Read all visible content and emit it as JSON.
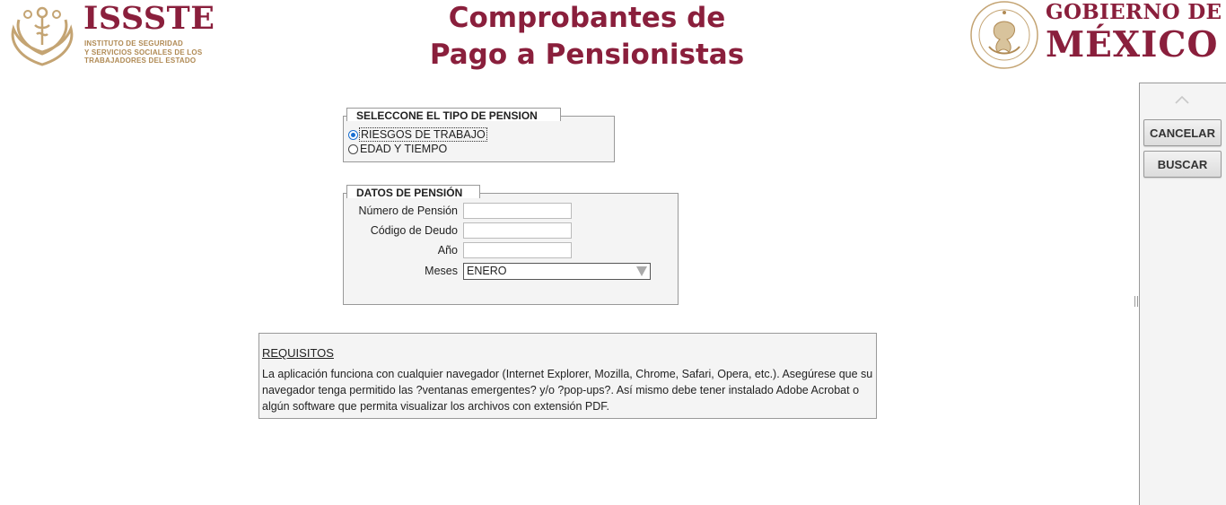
{
  "header": {
    "issste_name": "ISSSTE",
    "issste_subtitle_lines": [
      "INSTITUTO DE SEGURIDAD",
      "Y SERVICIOS SOCIALES DE LOS",
      "TRABAJADORES DEL ESTADO"
    ],
    "title_line1": "Comprobantes de",
    "title_line2": "Pago a Pensionistas",
    "gob_line1": "GOBIERNO DE",
    "gob_line2": "MÉXICO"
  },
  "pension_type": {
    "legend": "SELECCONE EL TIPO DE PENSION",
    "options": [
      {
        "label": "RIESGOS DE TRABAJO",
        "checked": true
      },
      {
        "label": "EDAD Y TIEMPO",
        "checked": false
      }
    ]
  },
  "pension_data": {
    "legend": "DATOS DE PENSIÓN",
    "fields": [
      {
        "label": "Número de Pensión",
        "value": ""
      },
      {
        "label": "Código de Deudo",
        "value": ""
      },
      {
        "label": "Año",
        "value": ""
      }
    ],
    "months_label": "Meses",
    "months_selected": "ENERO"
  },
  "requirements": {
    "title": "REQUISITOS",
    "text": "La aplicación funciona con cualquier navegador (Internet Explorer, Mozilla, Chrome, Safari, Opera, etc.). Asegúrese que su navegador tenga permitido las ?ventanas emergentes? y/o ?pop-ups?.  Así mismo debe tener instalado Adobe Acrobat o algún software que permita visualizar los archivos con extensión PDF."
  },
  "side_panel": {
    "cancel_label": "CANCELAR",
    "search_label": "BUSCAR"
  },
  "colors": {
    "brand": "#8a1f3c",
    "gold": "#b08a54"
  },
  "icons": {
    "collapse": "chevron-up-icon",
    "dropdown": "chevron-down-icon"
  }
}
